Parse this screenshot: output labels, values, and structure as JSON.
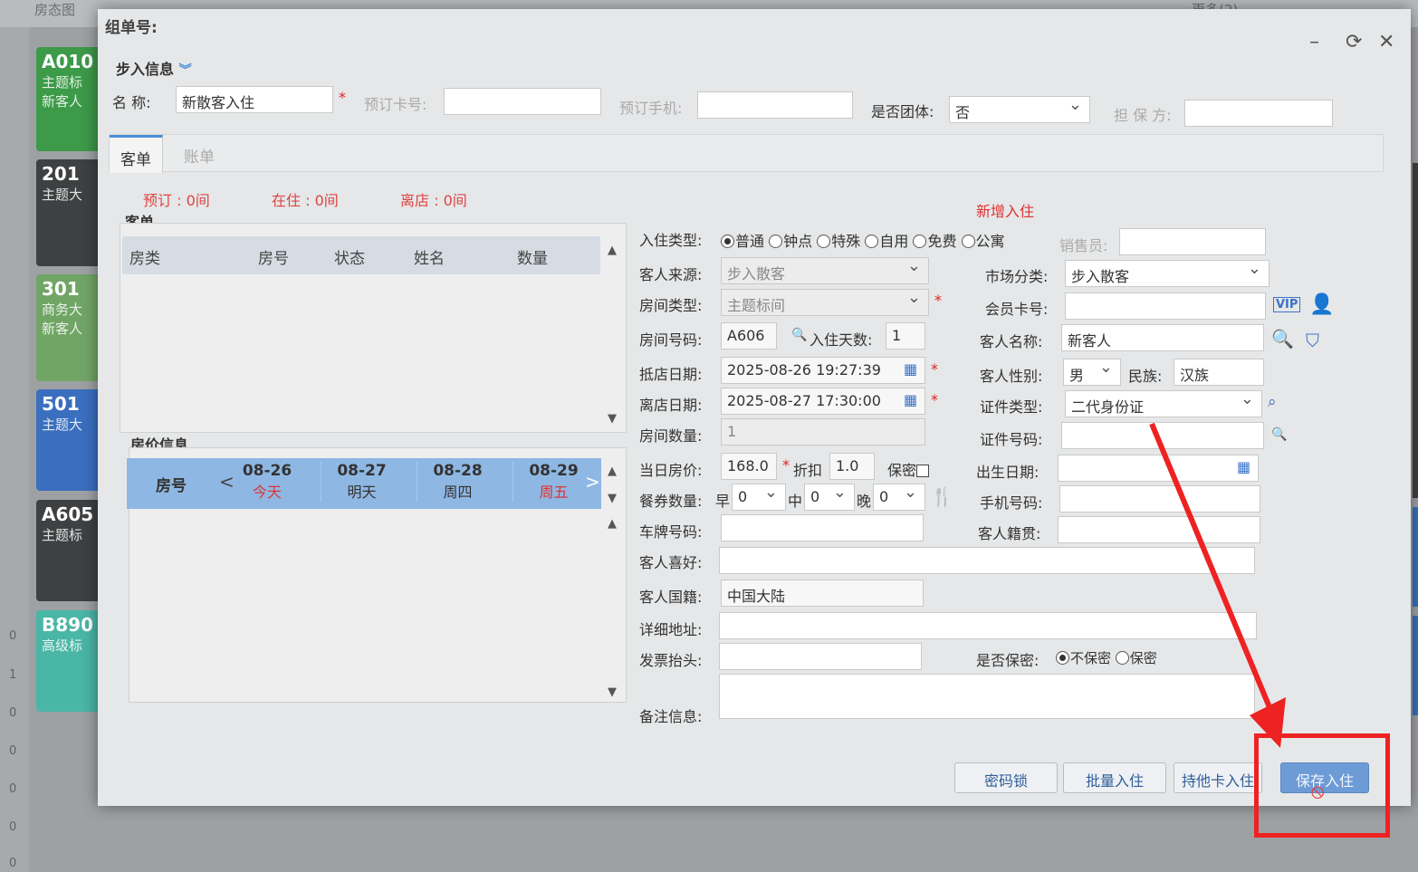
{
  "bg": {
    "nav_items": [
      "房态图",
      "",
      "",
      "",
      "",
      "",
      "",
      "",
      "",
      "更多(2)"
    ],
    "left_numbers": [
      "0",
      "1",
      "0",
      "0",
      "0",
      "0",
      "0"
    ],
    "tiles": [
      {
        "num": "A010",
        "sub1": "主题标",
        "sub2": "新客人",
        "color": "#3c9a49"
      },
      {
        "num": "201",
        "sub1": "主题大",
        "sub2": "",
        "color": "#3e4042"
      },
      {
        "num": "301",
        "sub1": "商务大",
        "sub2": "新客人",
        "color": "#71a566"
      },
      {
        "num": "501",
        "sub1": "主题大",
        "sub2": "",
        "color": "#3a6fbf"
      },
      {
        "num": "A605",
        "sub1": "主题标",
        "sub2": "",
        "color": "#3e4042"
      },
      {
        "num": "B890",
        "sub1": "高级标",
        "sub2": "",
        "color": "#4ab6a6"
      }
    ]
  },
  "dialog": {
    "title": "组单号:",
    "walkin_section": "步入信息",
    "name_label": "名  称:",
    "name_value": "新散客入住",
    "booking_card_label": "预订卡号:",
    "booking_phone_label": "预订手机:",
    "is_group_label": "是否团体:",
    "is_group_value": "否",
    "guarantor_label": "担 保 方:",
    "tabs": [
      "客单",
      "账单"
    ],
    "stats": [
      "预订 : 0间",
      "在住 : 0间",
      "离店 : 0间"
    ],
    "guest_list_title": "客单",
    "guest_cols": [
      "房类",
      "房号",
      "状态",
      "姓名",
      "数量"
    ],
    "price_title": "房价信息",
    "price_room_col": "房号",
    "price_days": [
      {
        "date": "08-26",
        "week": "今天",
        "red": true
      },
      {
        "date": "08-27",
        "week": "明天",
        "red": false
      },
      {
        "date": "08-28",
        "week": "周四",
        "red": false
      },
      {
        "date": "08-29",
        "week": "周五",
        "red": true
      }
    ],
    "new_checkin": "新增入住",
    "checkin_type_label": "入住类型:",
    "checkin_types": [
      "普通",
      "钟点",
      "特殊",
      "自用",
      "免费",
      "公寓"
    ],
    "salesperson_label": "销售员:",
    "guest_source_label": "客人来源:",
    "guest_source_value": "步入散客",
    "market_label": "市场分类:",
    "market_value": "步入散客",
    "room_type_label": "房间类型:",
    "room_type_value": "主题标间",
    "member_card_label": "会员卡号:",
    "vip": "VIP",
    "room_no_label": "房间号码:",
    "room_no_value": "A606",
    "nights_label": "入住天数:",
    "nights_value": "1",
    "guest_name_label": "客人名称:",
    "guest_name_value": "新客人",
    "arrive_label": "抵店日期:",
    "arrive_value": "2025-08-26 19:27:39",
    "gender_label": "客人性别:",
    "gender_value": "男",
    "ethnic_label": "民族:",
    "ethnic_value": "汉族",
    "depart_label": "离店日期:",
    "depart_value": "2025-08-27 17:30:00",
    "id_type_label": "证件类型:",
    "id_type_value": "二代身份证",
    "room_qty_label": "房间数量:",
    "room_qty_value": "1",
    "id_no_label": "证件号码:",
    "rate_label": "当日房价:",
    "rate_value": "168.0",
    "discount_label": "折扣",
    "discount_value": "1.0",
    "secret_label": "保密",
    "birth_label": "出生日期:",
    "meal_label": "餐券数量:",
    "meal_b": "早",
    "meal_l": "中",
    "meal_d": "晚",
    "meal_b_val": "0",
    "meal_l_val": "0",
    "meal_d_val": "0",
    "phone_label": "手机号码:",
    "plate_label": "车牌号码:",
    "native_label": "客人籍贯:",
    "pref_label": "客人喜好:",
    "nationality_label": "客人国籍:",
    "nationality_value": "中国大陆",
    "address_label": "详细地址:",
    "invoice_label": "发票抬头:",
    "privacy_label": "是否保密:",
    "privacy_options": [
      "不保密",
      "保密"
    ],
    "remark_label": "备注信息:",
    "buttons": [
      "密码锁",
      "批量入住",
      "持他卡入住",
      "保存入住"
    ]
  }
}
